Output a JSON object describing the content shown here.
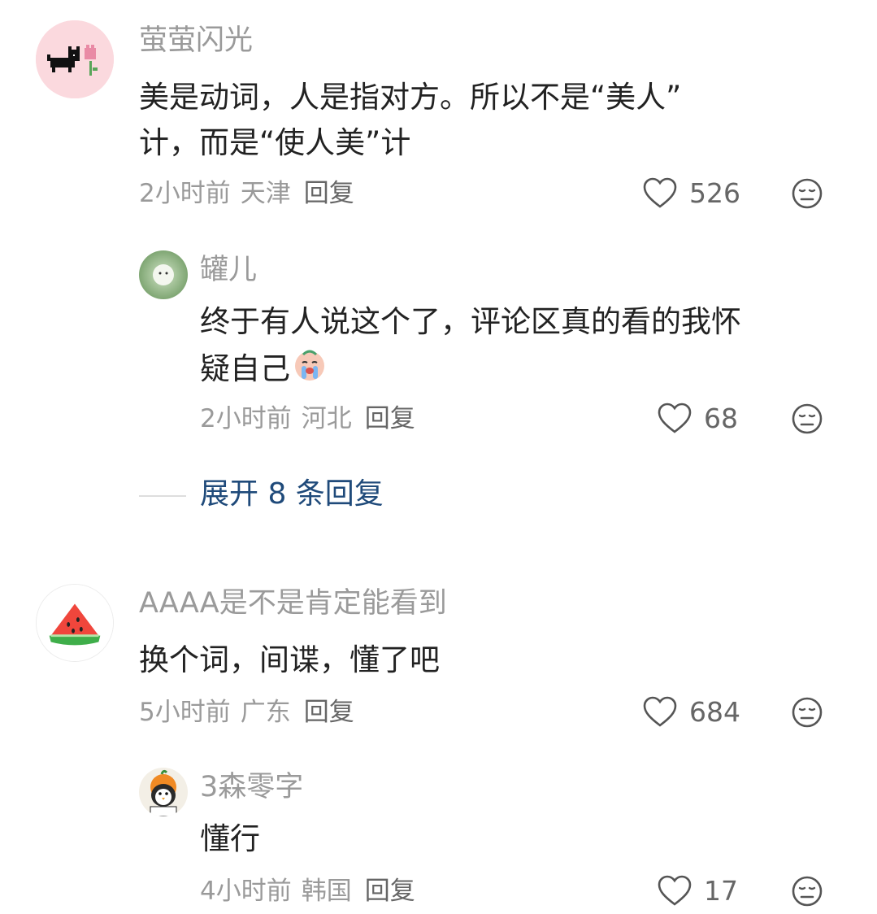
{
  "comments": [
    {
      "username": "萤萤闪光",
      "line1": "美是动词，人是指对方。所以不是“美人”",
      "line2": "计，而是“使人美”计",
      "time": "2小时前",
      "location": "天津",
      "reply": "回复",
      "likes": "526"
    },
    {
      "username": "罐儿",
      "line1": "终于有人说这个了，评论区真的看的我怀",
      "line2": "疑自己",
      "time": "2小时前",
      "location": "河北",
      "reply": "回复",
      "likes": "68"
    },
    {
      "username": "AAAA是不是肯定能看到",
      "line1": "换个词，间谍，懂了吧",
      "time": "5小时前",
      "location": "广东",
      "reply": "回复",
      "likes": "684"
    },
    {
      "username": "3森零字",
      "line1": "懂行",
      "time": "4小时前",
      "location": "韩国",
      "reply": "回复",
      "likes": "17"
    }
  ],
  "expand_replies": "展开 8 条回复",
  "colors": {
    "username": "#9a9a9a",
    "content": "#222222",
    "meta": "#9a9a9a",
    "expand": "#1f4a7a"
  },
  "icons": [
    "heart-icon",
    "dislike-face-icon",
    "crying-sticker-icon"
  ]
}
